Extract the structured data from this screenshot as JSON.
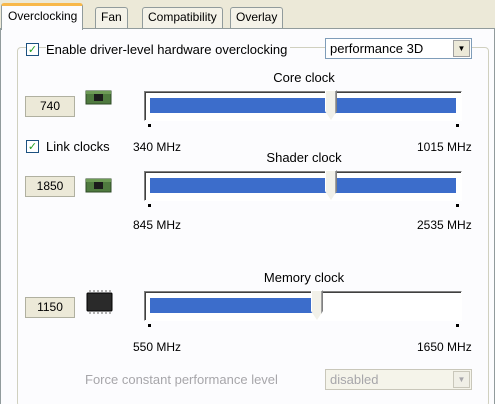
{
  "tabs": [
    {
      "label": "Overclocking",
      "active": true
    },
    {
      "label": "Fan"
    },
    {
      "label": "Compatibility"
    },
    {
      "label": "Overlay"
    }
  ],
  "enable_overclocking": {
    "label": "Enable driver-level hardware overclocking",
    "checked": true
  },
  "profile_combo": {
    "value": "performance 3D"
  },
  "core": {
    "title": "Core clock",
    "value": "740",
    "min": "340 MHz",
    "max": "1015 MHz",
    "fraction": 0.59
  },
  "link_clocks": {
    "label": "Link clocks",
    "checked": true
  },
  "shader": {
    "title": "Shader clock",
    "value": "1850",
    "min": "845 MHz",
    "max": "2535 MHz",
    "fraction": 0.59
  },
  "memory": {
    "title": "Memory clock",
    "value": "1150",
    "min": "550 MHz",
    "max": "1650 MHz",
    "fraction": 0.545
  },
  "force_perf": {
    "label": "Force constant performance level",
    "value": "disabled"
  },
  "colors": {
    "accent": "#3c6dcb",
    "tab_highlight": "#f8b84a"
  }
}
